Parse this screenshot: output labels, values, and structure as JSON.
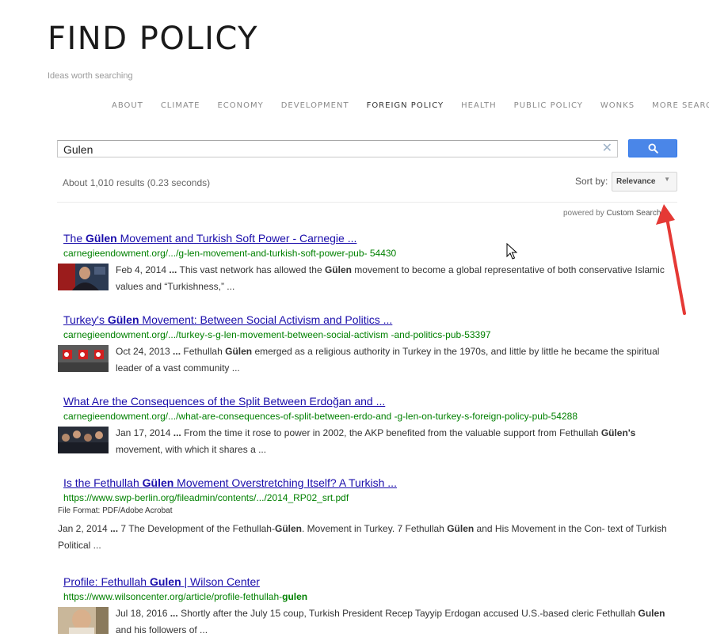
{
  "site": {
    "title": "FIND POLICY",
    "tagline": "Ideas worth searching"
  },
  "nav": [
    {
      "label": "ABOUT"
    },
    {
      "label": "CLIMATE"
    },
    {
      "label": "ECONOMY"
    },
    {
      "label": "DEVELOPMENT"
    },
    {
      "label": "FOREIGN POLICY",
      "active": true
    },
    {
      "label": "HEALTH"
    },
    {
      "label": "PUBLIC POLICY"
    },
    {
      "label": "WONKS"
    },
    {
      "label": "MORE SEARCH"
    }
  ],
  "search": {
    "value": "Gulen",
    "clear_icon": "close-icon",
    "button_icon": "search-icon",
    "button_color": "#4a86e8"
  },
  "results_info": "About 1,010 results (0.23 seconds)",
  "sort": {
    "label": "Sort by:",
    "value": "Relevance"
  },
  "powered_by": {
    "prefix": "powered by",
    "brand": "Custom Search"
  },
  "results": [
    {
      "title_parts": [
        "The ",
        "Gülen",
        " Movement and Turkish Soft Power - Carnegie ..."
      ],
      "url_parts": [
        "carnegieendowment.org/.../g-len-movement-and-turkish-soft-power-pub- 54430"
      ],
      "snippet_parts": [
        "Feb 4, 2014 ",
        "...",
        " This vast network has allowed the ",
        "Gülen",
        " movement to become a global representative of both conservative Islamic values and “Turkishness,” ..."
      ],
      "thumb": "erdogan-photo"
    },
    {
      "title_parts": [
        "Turkey's ",
        "Gülen",
        " Movement: Between Social Activism and Politics ..."
      ],
      "url_parts": [
        "carnegieendowment.org/.../turkey-s-g-len-movement-between-social-activism -and-politics-pub-53397"
      ],
      "snippet_parts": [
        "Oct 24, 2013 ",
        "...",
        " Fethullah ",
        "Gülen",
        " emerged as a religious authority in Turkey in the 1970s, and little by little he became the spiritual leader of a vast community ..."
      ],
      "thumb": "turkish-flags-photo"
    },
    {
      "title_parts": [
        "What Are the Consequences of the Split Between Erdoğan and ..."
      ],
      "url_parts": [
        "carnegieendowment.org/.../what-are-consequences-of-split-between-erdo-and -g-len-on-turkey-s-foreign-policy-pub-54288"
      ],
      "snippet_parts": [
        "Jan 17, 2014 ",
        "...",
        " From the time it rose to power in 2002, the AKP benefited from the valuable support from Fethullah ",
        "Gülen's",
        " movement, with which it shares a ..."
      ],
      "thumb": "crowd-photo"
    },
    {
      "title_parts": [
        "Is the Fethullah ",
        "Gülen",
        " Movement Overstretching Itself? A Turkish ..."
      ],
      "url_parts": [
        "https://www.swp-berlin.org/fileadmin/contents/.../2014_RP02_srt.pdf"
      ],
      "file_format": "File Format: PDF/Adobe Acrobat",
      "snippet_parts": [
        "Jan 2, 2014 ",
        "...",
        " 7 The Development of the Fethullah-",
        "Gülen",
        ". Movement in Turkey. 7 Fethullah ",
        "Gülen",
        " and His Movement in the Con- text of Turkish Political ..."
      ]
    },
    {
      "title_parts": [
        "Profile: Fethullah ",
        "Gulen",
        " | Wilson Center"
      ],
      "url_parts": [
        "https://www.wilsoncenter.org/article/profile-fethullah-",
        "gulen"
      ],
      "snippet_parts": [
        "Jul 18, 2016 ",
        "...",
        " Shortly after the July 15 coup, Turkish President Recep Tayyip Erdogan accused U.S.-based cleric Fethullah ",
        "Gulen",
        " and his followers of ..."
      ],
      "thumb": "gulen-photo"
    }
  ]
}
